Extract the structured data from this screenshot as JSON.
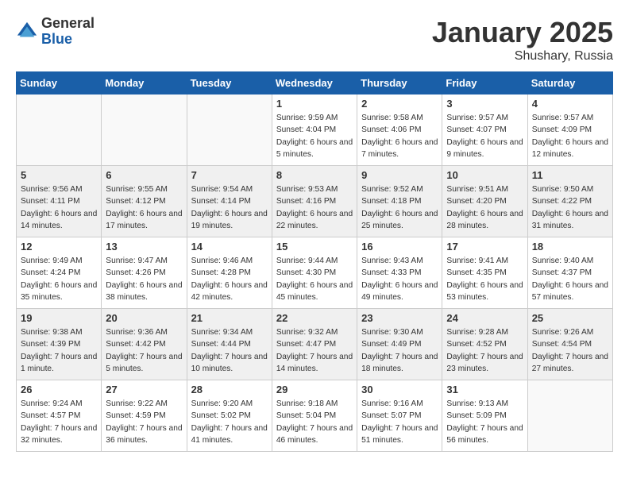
{
  "header": {
    "logo_general": "General",
    "logo_blue": "Blue",
    "month_title": "January 2025",
    "location": "Shushary, Russia"
  },
  "days_of_week": [
    "Sunday",
    "Monday",
    "Tuesday",
    "Wednesday",
    "Thursday",
    "Friday",
    "Saturday"
  ],
  "weeks": [
    [
      {
        "num": "",
        "info": ""
      },
      {
        "num": "",
        "info": ""
      },
      {
        "num": "",
        "info": ""
      },
      {
        "num": "1",
        "info": "Sunrise: 9:59 AM\nSunset: 4:04 PM\nDaylight: 6 hours and 5 minutes."
      },
      {
        "num": "2",
        "info": "Sunrise: 9:58 AM\nSunset: 4:06 PM\nDaylight: 6 hours and 7 minutes."
      },
      {
        "num": "3",
        "info": "Sunrise: 9:57 AM\nSunset: 4:07 PM\nDaylight: 6 hours and 9 minutes."
      },
      {
        "num": "4",
        "info": "Sunrise: 9:57 AM\nSunset: 4:09 PM\nDaylight: 6 hours and 12 minutes."
      }
    ],
    [
      {
        "num": "5",
        "info": "Sunrise: 9:56 AM\nSunset: 4:11 PM\nDaylight: 6 hours and 14 minutes."
      },
      {
        "num": "6",
        "info": "Sunrise: 9:55 AM\nSunset: 4:12 PM\nDaylight: 6 hours and 17 minutes."
      },
      {
        "num": "7",
        "info": "Sunrise: 9:54 AM\nSunset: 4:14 PM\nDaylight: 6 hours and 19 minutes."
      },
      {
        "num": "8",
        "info": "Sunrise: 9:53 AM\nSunset: 4:16 PM\nDaylight: 6 hours and 22 minutes."
      },
      {
        "num": "9",
        "info": "Sunrise: 9:52 AM\nSunset: 4:18 PM\nDaylight: 6 hours and 25 minutes."
      },
      {
        "num": "10",
        "info": "Sunrise: 9:51 AM\nSunset: 4:20 PM\nDaylight: 6 hours and 28 minutes."
      },
      {
        "num": "11",
        "info": "Sunrise: 9:50 AM\nSunset: 4:22 PM\nDaylight: 6 hours and 31 minutes."
      }
    ],
    [
      {
        "num": "12",
        "info": "Sunrise: 9:49 AM\nSunset: 4:24 PM\nDaylight: 6 hours and 35 minutes."
      },
      {
        "num": "13",
        "info": "Sunrise: 9:47 AM\nSunset: 4:26 PM\nDaylight: 6 hours and 38 minutes."
      },
      {
        "num": "14",
        "info": "Sunrise: 9:46 AM\nSunset: 4:28 PM\nDaylight: 6 hours and 42 minutes."
      },
      {
        "num": "15",
        "info": "Sunrise: 9:44 AM\nSunset: 4:30 PM\nDaylight: 6 hours and 45 minutes."
      },
      {
        "num": "16",
        "info": "Sunrise: 9:43 AM\nSunset: 4:33 PM\nDaylight: 6 hours and 49 minutes."
      },
      {
        "num": "17",
        "info": "Sunrise: 9:41 AM\nSunset: 4:35 PM\nDaylight: 6 hours and 53 minutes."
      },
      {
        "num": "18",
        "info": "Sunrise: 9:40 AM\nSunset: 4:37 PM\nDaylight: 6 hours and 57 minutes."
      }
    ],
    [
      {
        "num": "19",
        "info": "Sunrise: 9:38 AM\nSunset: 4:39 PM\nDaylight: 7 hours and 1 minute."
      },
      {
        "num": "20",
        "info": "Sunrise: 9:36 AM\nSunset: 4:42 PM\nDaylight: 7 hours and 5 minutes."
      },
      {
        "num": "21",
        "info": "Sunrise: 9:34 AM\nSunset: 4:44 PM\nDaylight: 7 hours and 10 minutes."
      },
      {
        "num": "22",
        "info": "Sunrise: 9:32 AM\nSunset: 4:47 PM\nDaylight: 7 hours and 14 minutes."
      },
      {
        "num": "23",
        "info": "Sunrise: 9:30 AM\nSunset: 4:49 PM\nDaylight: 7 hours and 18 minutes."
      },
      {
        "num": "24",
        "info": "Sunrise: 9:28 AM\nSunset: 4:52 PM\nDaylight: 7 hours and 23 minutes."
      },
      {
        "num": "25",
        "info": "Sunrise: 9:26 AM\nSunset: 4:54 PM\nDaylight: 7 hours and 27 minutes."
      }
    ],
    [
      {
        "num": "26",
        "info": "Sunrise: 9:24 AM\nSunset: 4:57 PM\nDaylight: 7 hours and 32 minutes."
      },
      {
        "num": "27",
        "info": "Sunrise: 9:22 AM\nSunset: 4:59 PM\nDaylight: 7 hours and 36 minutes."
      },
      {
        "num": "28",
        "info": "Sunrise: 9:20 AM\nSunset: 5:02 PM\nDaylight: 7 hours and 41 minutes."
      },
      {
        "num": "29",
        "info": "Sunrise: 9:18 AM\nSunset: 5:04 PM\nDaylight: 7 hours and 46 minutes."
      },
      {
        "num": "30",
        "info": "Sunrise: 9:16 AM\nSunset: 5:07 PM\nDaylight: 7 hours and 51 minutes."
      },
      {
        "num": "31",
        "info": "Sunrise: 9:13 AM\nSunset: 5:09 PM\nDaylight: 7 hours and 56 minutes."
      },
      {
        "num": "",
        "info": ""
      }
    ]
  ]
}
